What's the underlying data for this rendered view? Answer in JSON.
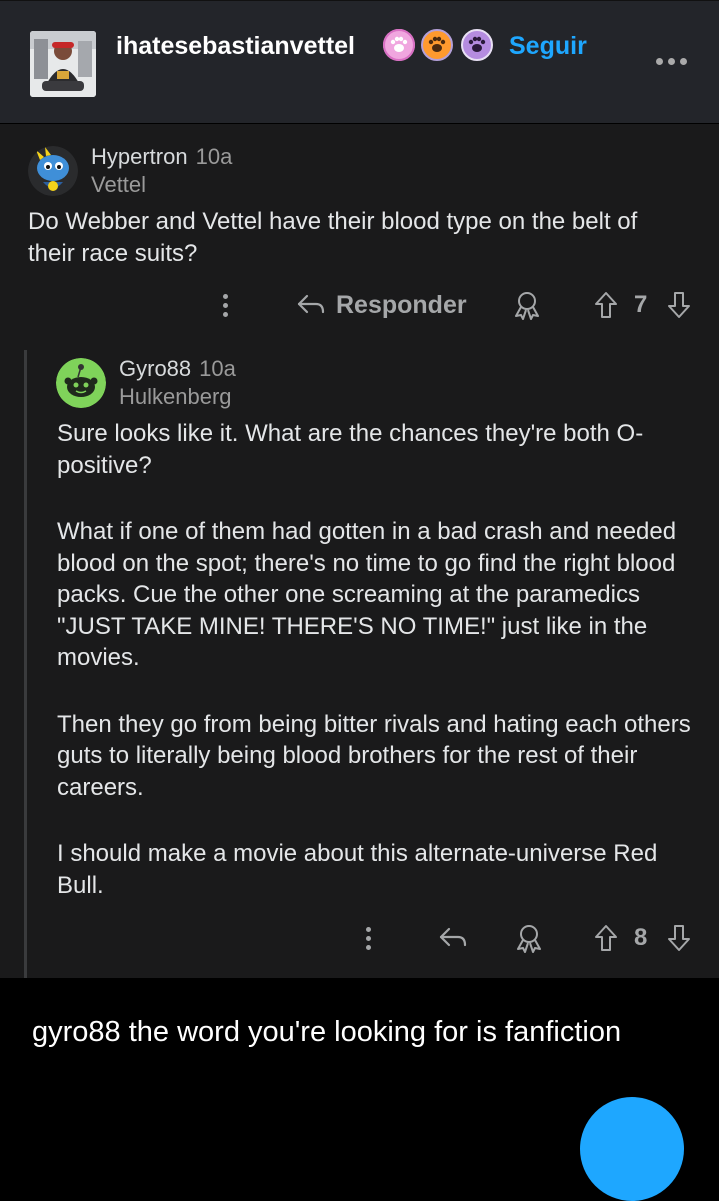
{
  "header": {
    "username": "ihatesebastianvettel",
    "follow_label": "Seguir",
    "badges": [
      "paw-badge-pink",
      "paw-badge-orange",
      "paw-badge-purple"
    ],
    "colors": {
      "background": "#23252a",
      "follow": "#1ea7ff"
    }
  },
  "thread": {
    "colors": {
      "background": "#1a1a1b",
      "text": "#e4e6e8",
      "meta": "#9a9a9a"
    },
    "comments": [
      {
        "username": "Hypertron",
        "time": "10a",
        "flair": "Vettel",
        "avatar_icon": "snoo-blue-avatar",
        "body": [
          "Do Webber and Vettel have their blood type on the belt of their race suits?"
        ],
        "reply_label": "Responder",
        "votes": "7"
      },
      {
        "username": "Gyro88",
        "time": "10a",
        "flair": "Hulkenberg",
        "avatar_icon": "snoo-green-avatar",
        "body": [
          "Sure looks like it. What are the chances they're both O-positive?",
          "What if one of them had gotten in a bad crash and needed blood on the spot; there's no time to go find the right blood packs. Cue the other one screaming at the paramedics \"JUST TAKE MINE! THERE'S NO TIME!\" just like in the movies.",
          "Then they go from being bitter rivals and hating each others guts to literally being blood brothers for the rest of their careers.",
          "I should make a movie about this alternate-universe Red Bull."
        ],
        "votes": "8"
      }
    ]
  },
  "caption": {
    "text": "gyro88 the word you're looking for is fanfiction"
  }
}
